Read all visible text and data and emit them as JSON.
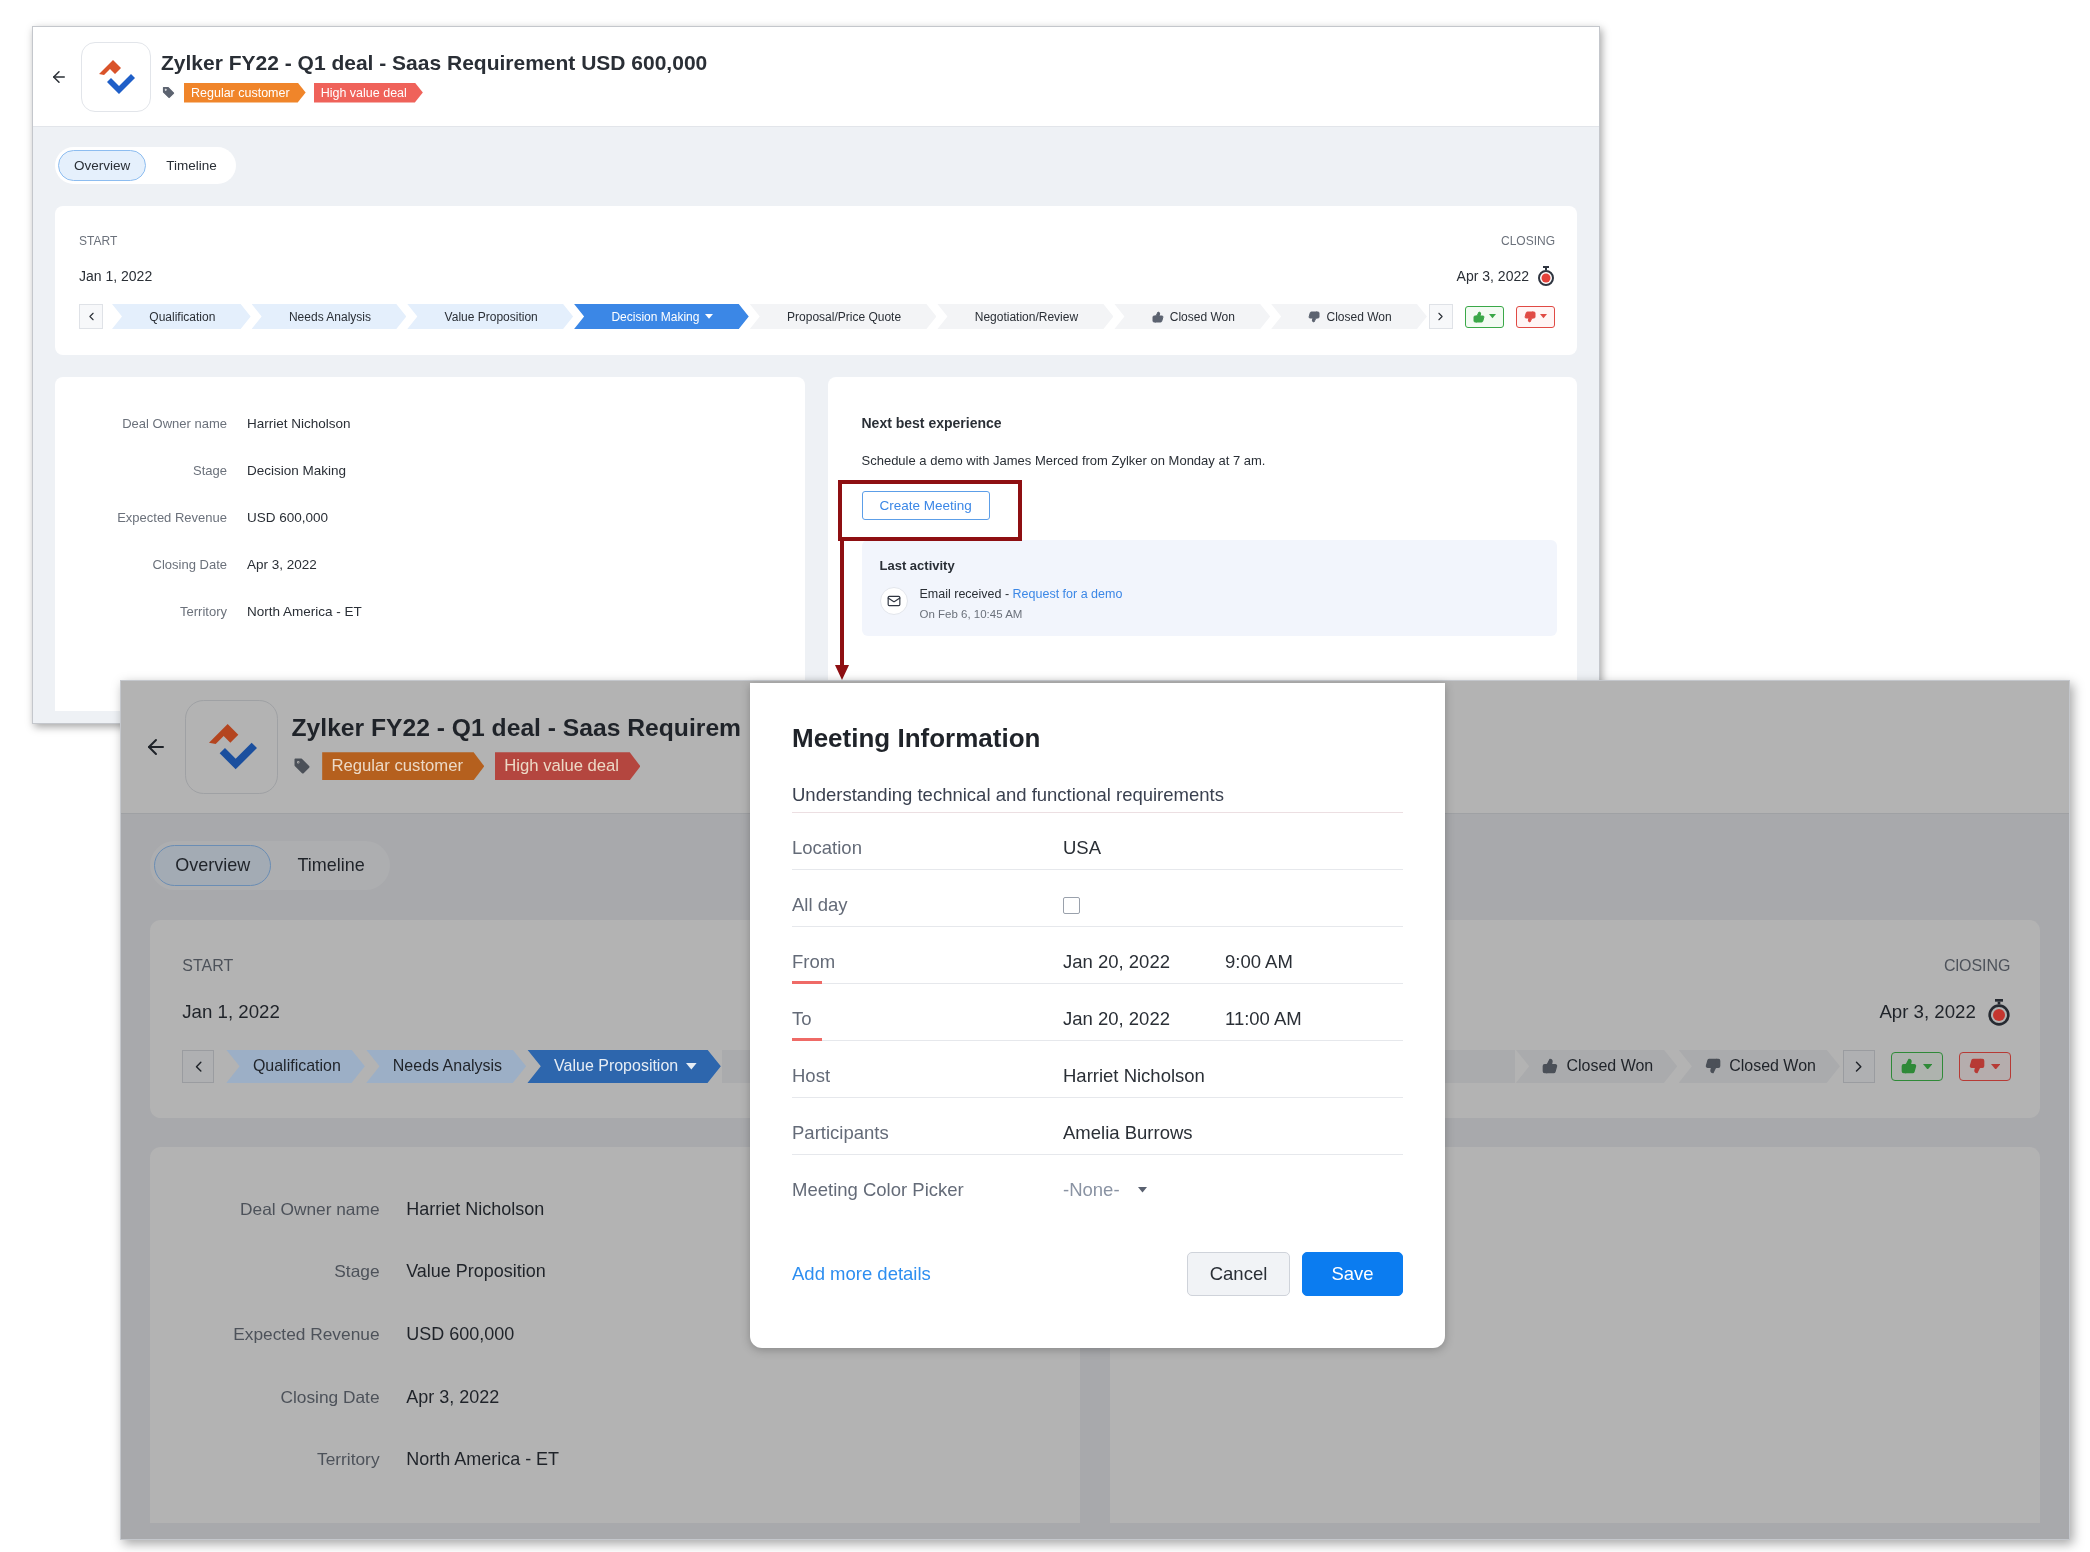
{
  "windows": [
    {
      "title": "Zylker FY22 - Q1 deal - Saas Requirement USD 600,000",
      "tags": [
        {
          "label": "Regular customer",
          "color": "#f0852a"
        },
        {
          "label": "High value deal",
          "color": "#ef625a"
        }
      ],
      "tabs": [
        {
          "label": "Overview",
          "selected": true
        },
        {
          "label": "Timeline",
          "selected": false
        }
      ],
      "start_label": "START",
      "start_date": "Jan 1, 2022",
      "closing_label": "CLOSING",
      "closing_date": "Apr 3, 2022",
      "stages": [
        {
          "label": "Qualification",
          "kind": "stage",
          "completed": true,
          "selected": false
        },
        {
          "label": "Needs Analysis",
          "kind": "stage",
          "completed": true,
          "selected": false
        },
        {
          "label": "Value Proposition",
          "kind": "stage",
          "completed": true,
          "selected": false
        },
        {
          "label": "Decision Making",
          "kind": "stage",
          "completed": false,
          "selected": true
        },
        {
          "label": "Proposal/Price Quote",
          "kind": "stage",
          "completed": false,
          "selected": false
        },
        {
          "label": "Negotiation/Review",
          "kind": "stage",
          "completed": false,
          "selected": false
        },
        {
          "label": "Closed Won",
          "kind": "won",
          "completed": false,
          "selected": false
        },
        {
          "label": "Closed Won",
          "kind": "lost",
          "completed": false,
          "selected": false
        }
      ],
      "details": [
        {
          "label": "Deal Owner name",
          "value": "Harriet Nicholson"
        },
        {
          "label": "Stage",
          "value": "Decision Making"
        },
        {
          "label": "Expected Revenue",
          "value": "USD 600,000"
        },
        {
          "label": "Closing Date",
          "value": "Apr 3, 2022"
        },
        {
          "label": "Territory",
          "value": "North America - ET"
        }
      ],
      "next_best": {
        "title": "Next best experience",
        "text": "Schedule a demo with James Merced from Zylker on Monday at 7 am.",
        "button": "Create Meeting",
        "activity_title": "Last activity",
        "activity_text": "Email received - ",
        "activity_link": "Request for a demo",
        "activity_time": "On Feb 6, 10:45 AM"
      },
      "dimmed": false
    },
    {
      "title": "Zylker FY22 - Q1 deal - Saas Requirem",
      "tags": [
        {
          "label": "Regular customer",
          "color": "#b5601e"
        },
        {
          "label": "High value deal",
          "color": "#b4463f"
        }
      ],
      "tabs": [
        {
          "label": "Overview",
          "selected": true
        },
        {
          "label": "Timeline",
          "selected": false
        }
      ],
      "start_label": "START",
      "start_date": "Jan 1, 2022",
      "closing_label": "ClOSING",
      "closing_date": "Apr 3, 2022",
      "stages": [
        {
          "label": "Qualification",
          "kind": "stage",
          "completed": true,
          "selected": false
        },
        {
          "label": "Needs Analysis",
          "kind": "stage",
          "completed": true,
          "selected": false
        },
        {
          "label": "Value Proposition",
          "kind": "stage",
          "completed": false,
          "selected": true
        }
      ],
      "stages_end": [
        {
          "label": "Closed Won",
          "kind": "won",
          "completed": false,
          "selected": false
        },
        {
          "label": "Closed Won",
          "kind": "lost",
          "completed": false,
          "selected": false
        }
      ],
      "details": [
        {
          "label": "Deal Owner name",
          "value": "Harriet Nicholson"
        },
        {
          "label": "Stage",
          "value": "Value Proposition"
        },
        {
          "label": "Expected Revenue",
          "value": "USD 600,000"
        },
        {
          "label": "Closing Date",
          "value": "Apr 3, 2022"
        },
        {
          "label": "Territory",
          "value": "North America - ET"
        }
      ],
      "dimmed": true
    }
  ],
  "modal": {
    "title": "Meeting Information",
    "subject": "Understanding technical and functional requirements",
    "fields": [
      {
        "kind": "text",
        "label": "Location",
        "value": "USA",
        "required": false
      },
      {
        "kind": "checkbox",
        "label": "All day",
        "checked": false,
        "required": false
      },
      {
        "kind": "datetime",
        "label": "From",
        "date": "Jan 20, 2022",
        "time": "9:00 AM",
        "required": true
      },
      {
        "kind": "datetime",
        "label": "To",
        "date": "Jan 20, 2022",
        "time": "11:00 AM",
        "required": true
      },
      {
        "kind": "text",
        "label": "Host",
        "value": "Harriet Nicholson",
        "required": false
      },
      {
        "kind": "text",
        "label": "Participants",
        "value": "Amelia Burrows",
        "required": false
      },
      {
        "kind": "select",
        "label": "Meeting Color Picker",
        "placeholder": "-None-",
        "required": false
      }
    ],
    "link": "Add more details",
    "buttons": [
      {
        "label": "Cancel",
        "kind": "secondary"
      },
      {
        "label": "Save",
        "kind": "primary"
      }
    ]
  }
}
